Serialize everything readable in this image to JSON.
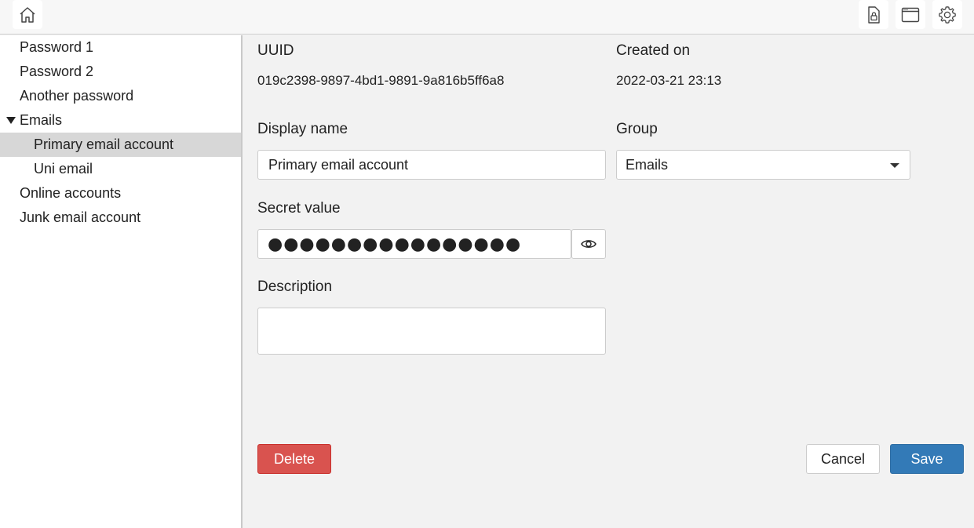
{
  "toolbar": {
    "home_icon": "home-icon",
    "right_icons": [
      "file-lock-icon",
      "window-icon",
      "gear-icon"
    ]
  },
  "sidebar": {
    "items": [
      {
        "label": "Password 1",
        "level": 0
      },
      {
        "label": "Password 2",
        "level": 0
      },
      {
        "label": "Another password",
        "level": 0
      },
      {
        "label": "Emails",
        "level": 0,
        "expanded": true
      },
      {
        "label": "Primary email account",
        "level": 1,
        "selected": true
      },
      {
        "label": "Uni email",
        "level": 1
      },
      {
        "label": "Online accounts",
        "level": 0
      },
      {
        "label": "Junk email account",
        "level": 0
      }
    ]
  },
  "detail": {
    "uuid_label": "UUID",
    "uuid_value": "019c2398-9897-4bd1-9891-9a816b5ff6a8",
    "created_label": "Created on",
    "created_value": "2022-03-21 23:13",
    "display_name_label": "Display name",
    "display_name_value": "Primary email account",
    "group_label": "Group",
    "group_value": "Emails",
    "secret_label": "Secret value",
    "secret_masked": "●●●●●●●●●●●●●●●●",
    "description_label": "Description",
    "description_value": ""
  },
  "actions": {
    "delete_label": "Delete",
    "cancel_label": "Cancel",
    "save_label": "Save"
  },
  "colors": {
    "delete": "#d9534f",
    "save": "#337ab7",
    "selected_row": "#d7d7d7"
  }
}
